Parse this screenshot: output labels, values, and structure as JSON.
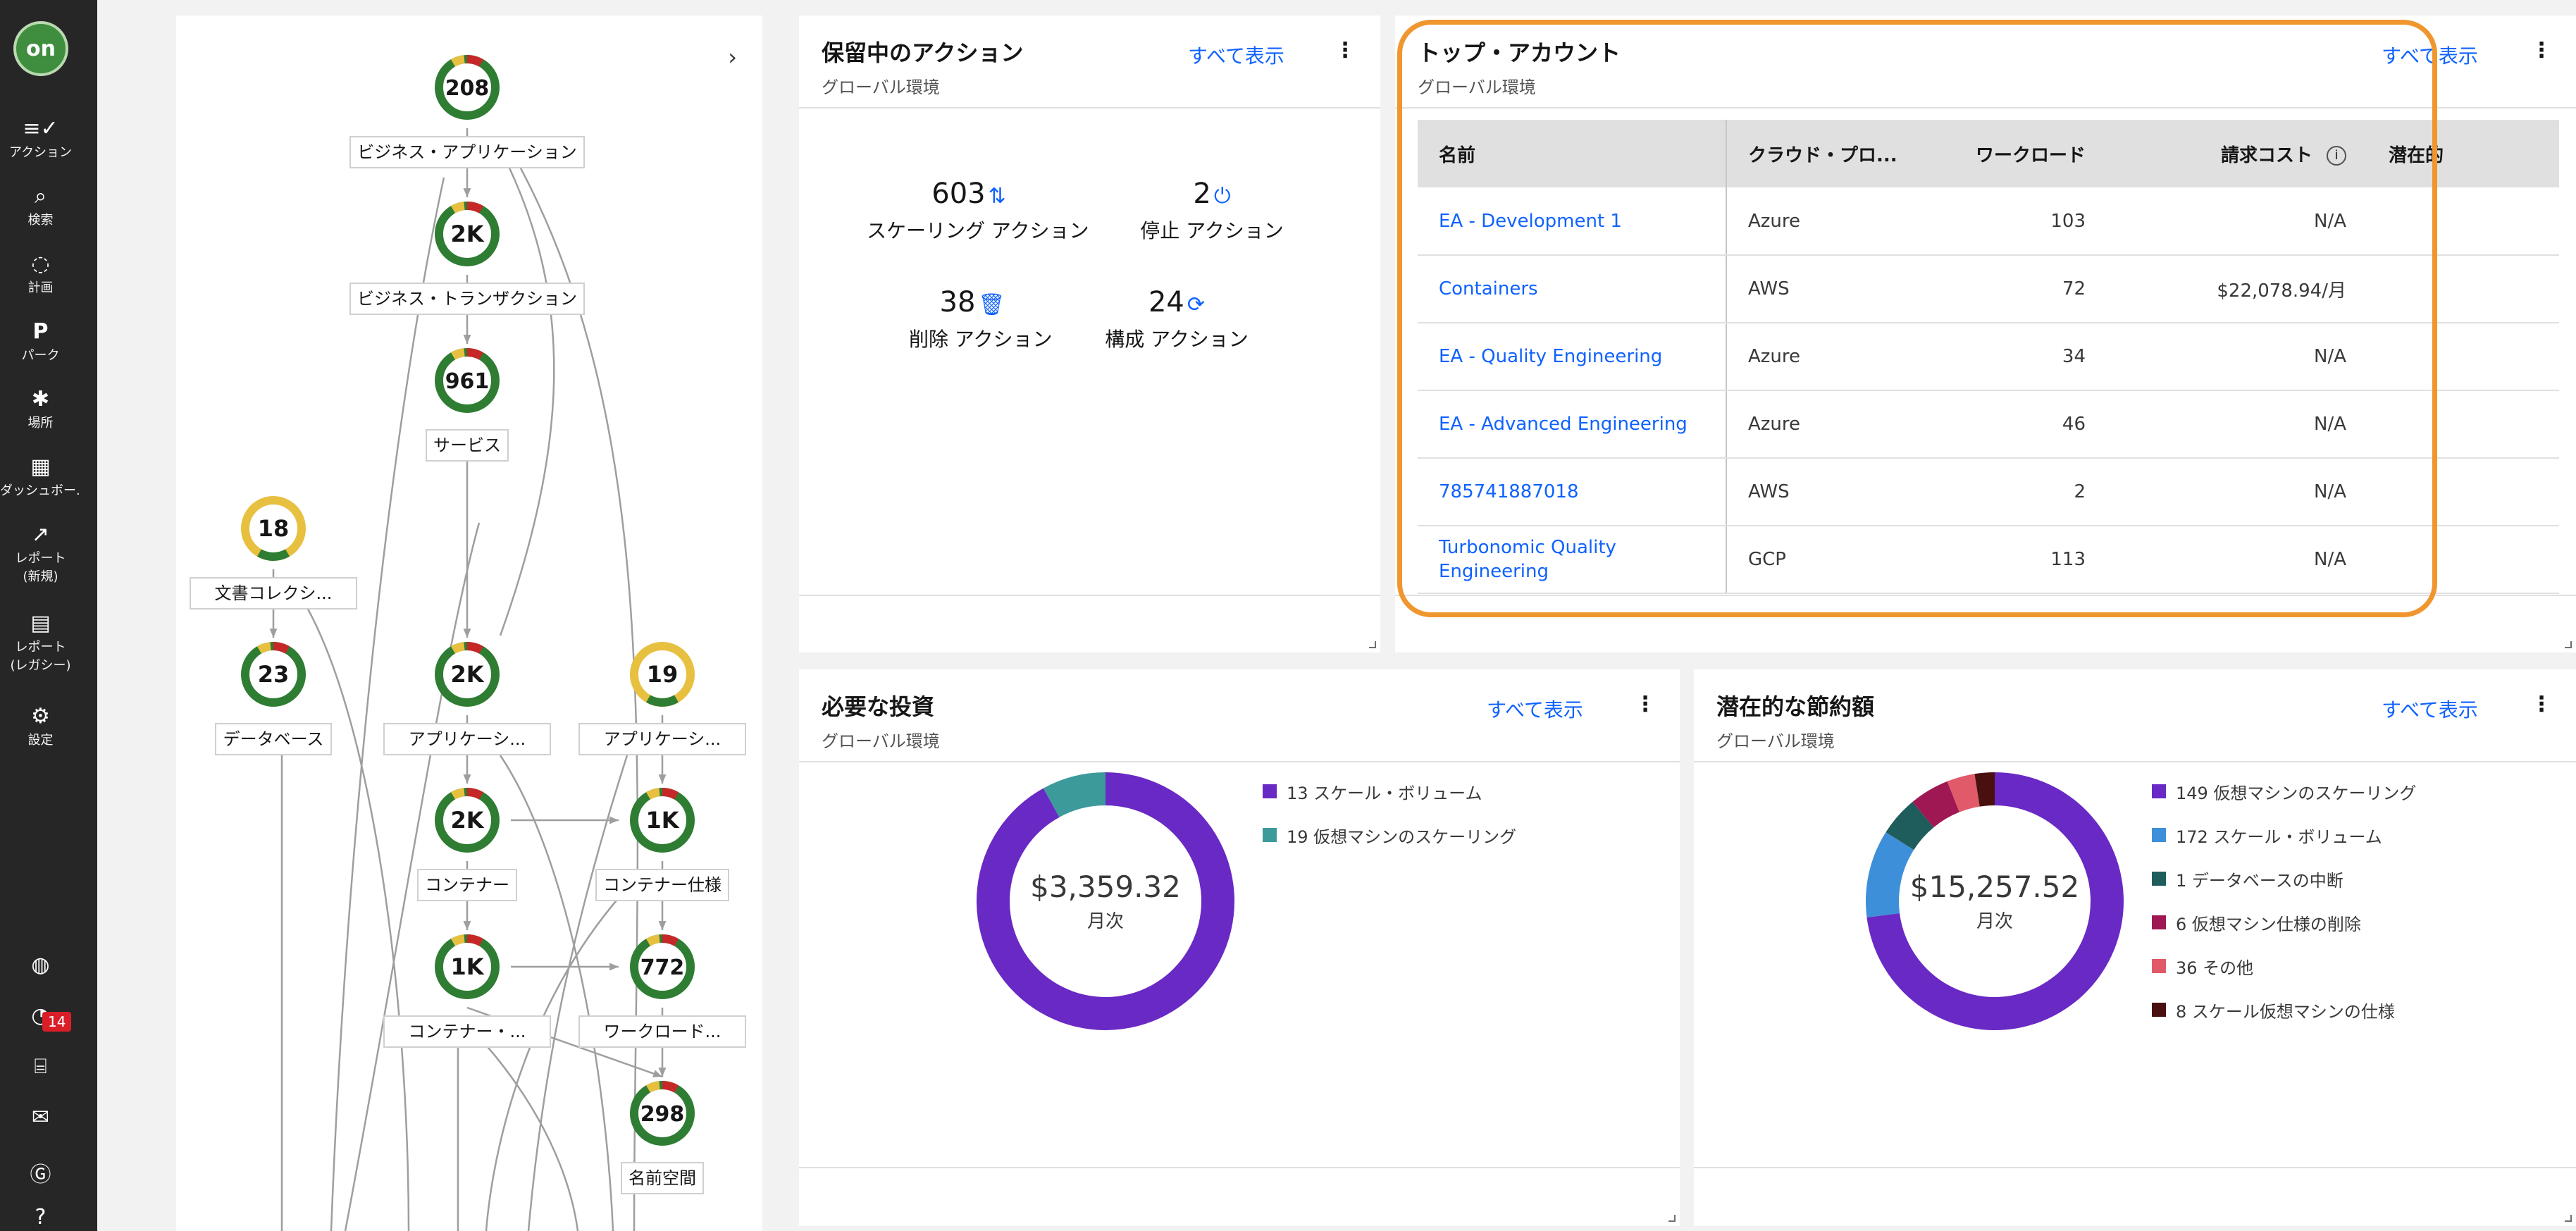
{
  "nav": {
    "logo": "on",
    "items": [
      {
        "icon": "≡✓",
        "label": "アクション"
      },
      {
        "icon": "⌕",
        "label": "検索"
      },
      {
        "icon": "◌",
        "label": "計画"
      },
      {
        "icon": "P",
        "label": "パーク"
      },
      {
        "icon": "✱",
        "label": "場所"
      },
      {
        "icon": "▦",
        "label": "ダッシュボー..."
      },
      {
        "icon": "↗",
        "label": "レポート\n(新規)"
      },
      {
        "icon": "▤",
        "label": "レポート\n(レガシー)"
      },
      {
        "icon": "⚙",
        "label": "設定"
      }
    ],
    "notification_count": "14"
  },
  "topology": {
    "nodes": [
      {
        "value": "208",
        "label": "ビジネス・アプリケーション"
      },
      {
        "value": "2K",
        "label": "ビジネス・トランザクション"
      },
      {
        "value": "961",
        "label": "サービス"
      },
      {
        "value": "18",
        "label": "文書コレクシ..."
      },
      {
        "value": "23",
        "label": "データベース"
      },
      {
        "value": "2K",
        "label": "アプリケーシ..."
      },
      {
        "value": "19",
        "label": "アプリケーシ..."
      },
      {
        "value": "2K",
        "label": "コンテナー"
      },
      {
        "value": "1K",
        "label": "コンテナー仕様"
      },
      {
        "value": "1K",
        "label": "コンテナー・..."
      },
      {
        "value": "772",
        "label": "ワークロード..."
      },
      {
        "value": "298",
        "label": "名前空間"
      }
    ]
  },
  "pending_actions": {
    "title": "保留中のアクション",
    "subtitle": "グローバル環境",
    "view_all": "すべて表示",
    "stats": [
      {
        "value": "603",
        "icon": "⇅",
        "label": "スケーリング アクション"
      },
      {
        "value": "2",
        "icon": "⏻",
        "label": "停止 アクション"
      },
      {
        "value": "38",
        "icon": "🗑",
        "label": "削除 アクション"
      },
      {
        "value": "24",
        "icon": "⟳",
        "label": "構成 アクション"
      }
    ]
  },
  "top_accounts": {
    "title": "トップ・アカウント",
    "subtitle": "グローバル環境",
    "view_all": "すべて表示",
    "columns": [
      "名前",
      "クラウド・プロ...",
      "ワークロード",
      "請求コスト",
      "潜在的"
    ],
    "rows": [
      {
        "name": "EA - Development 1",
        "cloud": "Azure",
        "workloads": "103",
        "cost": "N/A"
      },
      {
        "name": "Containers",
        "cloud": "AWS",
        "workloads": "72",
        "cost": "$22,078.94/月"
      },
      {
        "name": "EA - Quality Engineering",
        "cloud": "Azure",
        "workloads": "34",
        "cost": "N/A"
      },
      {
        "name": "EA - Advanced Engineering",
        "cloud": "Azure",
        "workloads": "46",
        "cost": "N/A"
      },
      {
        "name": "785741887018",
        "cloud": "AWS",
        "workloads": "2",
        "cost": "N/A"
      },
      {
        "name": "Turbonomic Quality Engineering",
        "cloud": "GCP",
        "workloads": "113",
        "cost": "N/A"
      }
    ]
  },
  "investments": {
    "title": "必要な投資",
    "subtitle": "グローバル環境",
    "view_all": "すべて表示",
    "amount": "$3,359.32",
    "period": "月次",
    "legend": [
      {
        "count": 13,
        "label": "13 スケール・ボリューム",
        "color": "#6929c4"
      },
      {
        "count": 19,
        "label": "19 仮想マシンのスケーリング",
        "color": "#3c9a9a"
      }
    ],
    "slices": [
      0.92,
      0.08
    ]
  },
  "savings": {
    "title": "潜在的な節約額",
    "subtitle": "グローバル環境",
    "view_all": "すべて表示",
    "amount": "$15,257.52",
    "period": "月次",
    "legend": [
      {
        "count": 149,
        "label": "149 仮想マシンのスケーリング",
        "color": "#6929c4"
      },
      {
        "count": 172,
        "label": "172 スケール・ボリューム",
        "color": "#3d8fd9"
      },
      {
        "count": 1,
        "label": "1 データベースの中断",
        "color": "#1f5c5c"
      },
      {
        "count": 6,
        "label": "6 仮想マシン仕様の削除",
        "color": "#9f1853"
      },
      {
        "count": 36,
        "label": "36 その他",
        "color": "#e05a6a"
      },
      {
        "count": 8,
        "label": "8 スケール仮想マシンの仕様",
        "color": "#4a1010"
      }
    ],
    "slices": [
      0.73,
      0.11,
      0.05,
      0.05,
      0.035,
      0.025
    ]
  }
}
